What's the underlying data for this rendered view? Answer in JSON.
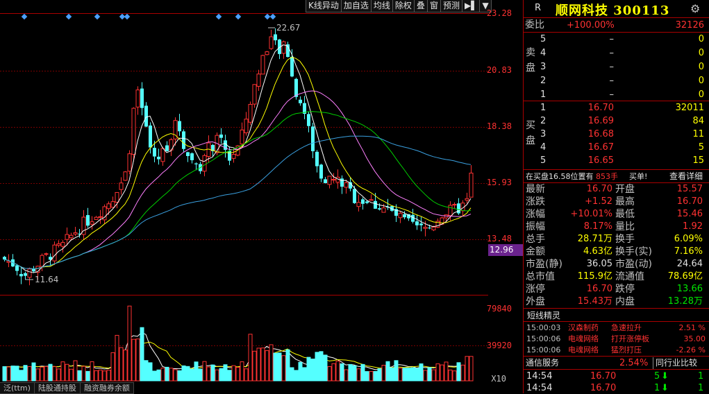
{
  "toolbar": {
    "buttons": [
      "K线异动",
      "加自选",
      "均线",
      "除权",
      "叠",
      "窗",
      "预测"
    ]
  },
  "chart": {
    "high_label": "22.67",
    "low_label": "11.64",
    "price_axis": [
      "23.28",
      "20.83",
      "18.38",
      "15.93",
      "13.48"
    ],
    "current_price": "12.96",
    "vol_axis": [
      "79840",
      "39920"
    ],
    "vol_unit": "X10"
  },
  "header": {
    "badge": "R",
    "name": "顺网科技 300113"
  },
  "order_book": {
    "ratio_label": "委比",
    "ratio_value": "+100.00%",
    "ratio_diff": "32126",
    "sell_side": "卖盘",
    "buy_side": "买盘",
    "sell": [
      {
        "level": "5",
        "price": "–",
        "vol": "0"
      },
      {
        "level": "4",
        "price": "–",
        "vol": "0"
      },
      {
        "level": "3",
        "price": "–",
        "vol": "0"
      },
      {
        "level": "2",
        "price": "–",
        "vol": "0"
      },
      {
        "level": "1",
        "price": "–",
        "vol": "0"
      }
    ],
    "buy": [
      {
        "level": "1",
        "price": "16.70",
        "vol": "32011"
      },
      {
        "level": "2",
        "price": "16.69",
        "vol": "84"
      },
      {
        "level": "3",
        "price": "16.68",
        "vol": "11"
      },
      {
        "level": "4",
        "price": "16.67",
        "vol": "5"
      },
      {
        "level": "5",
        "price": "16.65",
        "vol": "15"
      }
    ]
  },
  "position_note": {
    "text": "在买盘16.58位置有",
    "vol": "853手",
    "tag": "买单!",
    "link": "查看详细"
  },
  "quote": [
    {
      "l1": "最新",
      "v1": "16.70",
      "c1": "red",
      "l2": "开盘",
      "v2": "15.57",
      "c2": "red"
    },
    {
      "l1": "涨跌",
      "v1": "+1.52",
      "c1": "red",
      "l2": "最高",
      "v2": "16.70",
      "c2": "red"
    },
    {
      "l1": "涨幅",
      "v1": "+10.01%",
      "c1": "red",
      "l2": "最低",
      "v2": "15.46",
      "c2": "red"
    },
    {
      "l1": "振幅",
      "v1": "8.17%",
      "c1": "red",
      "l2": "量比",
      "v2": "1.92",
      "c2": "red"
    },
    {
      "l1": "总手",
      "v1": "28.71万",
      "c1": "yellow",
      "l2": "换手",
      "v2": "6.09%",
      "c2": "yellow"
    },
    {
      "l1": "金额",
      "v1": "4.63亿",
      "c1": "yellow",
      "l2": "换手(实)",
      "v2": "7.16%",
      "c2": "yellow"
    },
    {
      "l1": "市盈(静)",
      "v1": "36.05",
      "c1": "white",
      "l2": "市盈(动)",
      "v2": "24.64",
      "c2": "white"
    },
    {
      "l1": "总市值",
      "v1": "115.9亿",
      "c1": "yellow",
      "l2": "流通值",
      "v2": "78.69亿",
      "c2": "yellow"
    },
    {
      "l1": "涨停",
      "v1": "16.70",
      "c1": "red",
      "l2": "跌停",
      "v2": "13.66",
      "c2": "green"
    },
    {
      "l1": "外盘",
      "v1": "15.43万",
      "c1": "red",
      "l2": "内盘",
      "v2": "13.28万",
      "c2": "green"
    }
  ],
  "spirit": {
    "title": "短线精灵",
    "rows": [
      {
        "time": "15:00:03",
        "name": "汉森制药",
        "event": "急速拉升",
        "value": "2.51 %"
      },
      {
        "time": "15:00:06",
        "name": "电魂网络",
        "event": "打开涨停板",
        "value": "35.00"
      },
      {
        "time": "15:00:06",
        "name": "电魂网络",
        "event": "猛烈打压",
        "value": "-2.26 %"
      }
    ]
  },
  "industry": {
    "name": "通信服务",
    "change": "2.54%",
    "compare": "同行业比较"
  },
  "ticks": [
    {
      "time": "14:54",
      "price": "16.70",
      "vol": "5",
      "edge": "1"
    },
    {
      "time": "14:54",
      "price": "16.70",
      "vol": "1",
      "edge": "1"
    }
  ],
  "bottom_tabs": [
    "泛(ttm)",
    "陆股通持股",
    "融资融券余额"
  ],
  "colors": {
    "up": "#ff3232",
    "down": "#54ffff",
    "ma5": "#ffffff",
    "ma10": "#ffff00",
    "ma20": "#ff80ff",
    "ma30": "#00d000",
    "ma60": "#3aa0e0"
  }
}
